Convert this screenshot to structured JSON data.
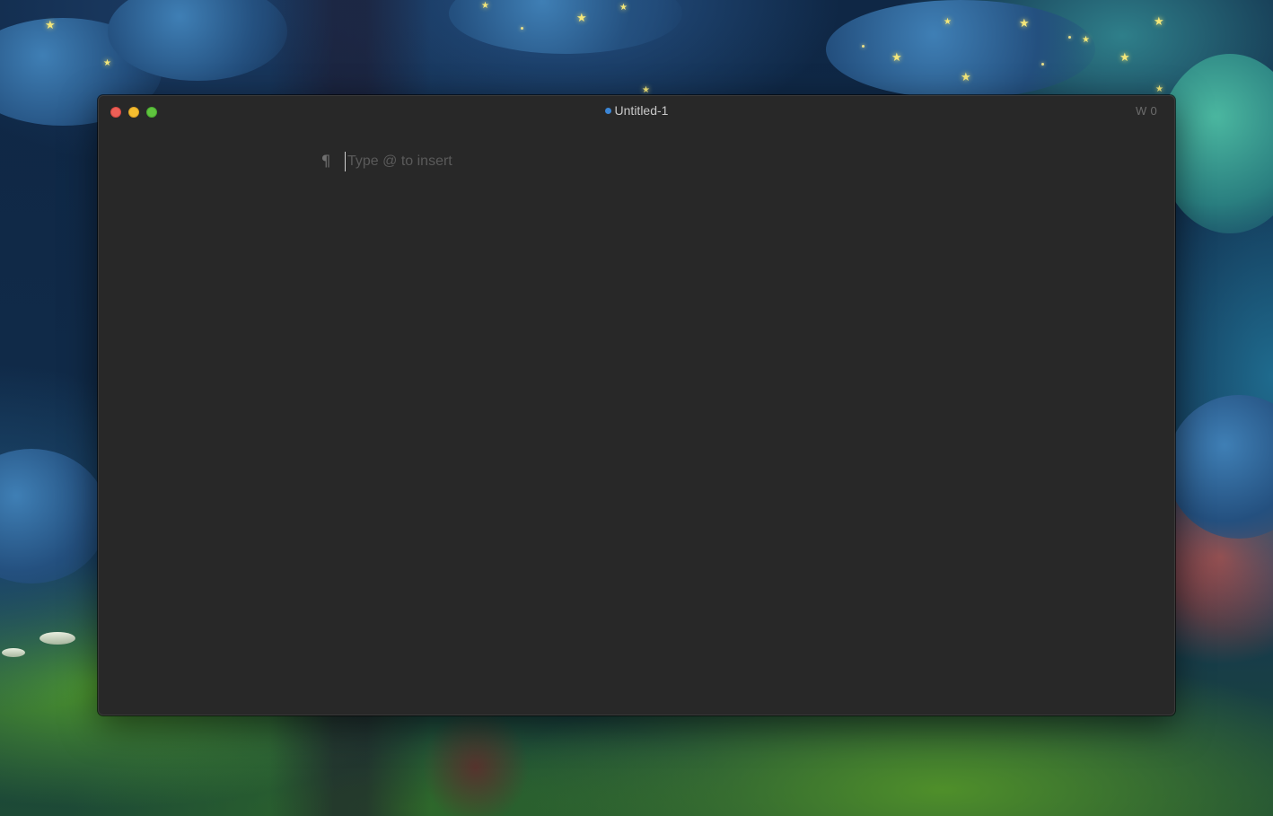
{
  "window": {
    "title": "Untitled-1",
    "word_count": "W 0",
    "unsaved_indicator_color": "#3b86d6"
  },
  "editor": {
    "block_icon": "pilcrow-icon",
    "value": "",
    "placeholder": "Type @ to insert"
  },
  "colors": {
    "window_background": "#282828",
    "close": "#ed5f57",
    "minimize": "#f4bd2f",
    "maximize": "#5fc43e"
  }
}
